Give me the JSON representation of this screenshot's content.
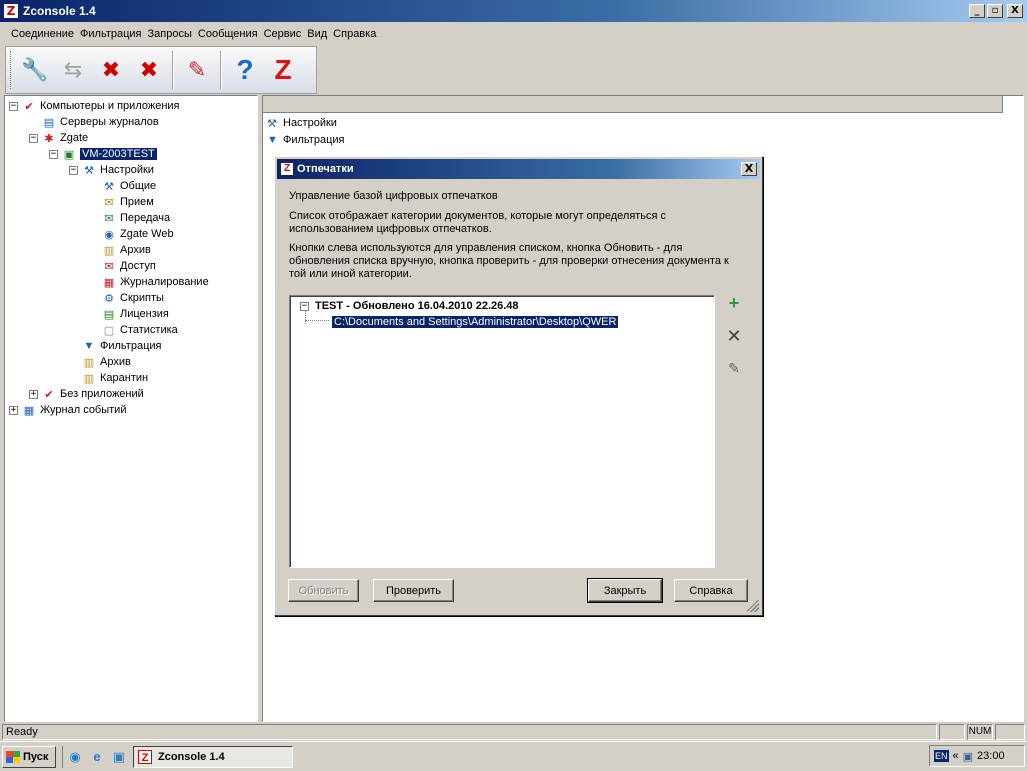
{
  "window": {
    "title": "Zconsole 1.4",
    "app_icon": "Z",
    "controls": {
      "minimize": "_",
      "maximize": "▫",
      "close": "X"
    }
  },
  "menu": [
    "Соединение",
    "Фильтрация",
    "Запросы",
    "Сообщения",
    "Сервис",
    "Вид",
    "Справка"
  ],
  "toolbar": {
    "buttons": [
      {
        "name": "connect-settings-icon",
        "glyph": "🔧"
      },
      {
        "name": "disconnect-icon",
        "glyph": "⇆"
      },
      {
        "name": "delete-server-icon",
        "glyph": "✖"
      },
      {
        "name": "delete-all-icon",
        "glyph": "✖"
      },
      {
        "name": "edit-icon",
        "glyph": "✎"
      },
      {
        "name": "help-icon",
        "glyph": "?"
      },
      {
        "name": "zgate-logo-icon",
        "glyph": "Z"
      }
    ]
  },
  "tree": [
    {
      "label": "Компьютеры и приложения",
      "level": 0,
      "exp": "-",
      "icon": "✔"
    },
    {
      "label": "Серверы журналов",
      "level": 1,
      "exp": "",
      "icon": "▤"
    },
    {
      "label": "Zgate",
      "level": 1,
      "exp": "-",
      "icon": "✱"
    },
    {
      "label": "VM-2003TEST",
      "level": 2,
      "exp": "-",
      "icon": "▣",
      "selected": true
    },
    {
      "label": "Настройки",
      "level": 3,
      "exp": "-",
      "icon": "⚒"
    },
    {
      "label": "Общие",
      "level": 4,
      "exp": "",
      "icon": "⚒"
    },
    {
      "label": "Прием",
      "level": 4,
      "exp": "",
      "icon": "✉"
    },
    {
      "label": "Передача",
      "level": 4,
      "exp": "",
      "icon": "✉"
    },
    {
      "label": "Zgate Web",
      "level": 4,
      "exp": "",
      "icon": "◉"
    },
    {
      "label": "Архив",
      "level": 4,
      "exp": "",
      "icon": "▥"
    },
    {
      "label": "Доступ",
      "level": 4,
      "exp": "",
      "icon": "✉"
    },
    {
      "label": "Журналирование",
      "level": 4,
      "exp": "",
      "icon": "▦"
    },
    {
      "label": "Скрипты",
      "level": 4,
      "exp": "",
      "icon": "⚙"
    },
    {
      "label": "Лицензия",
      "level": 4,
      "exp": "",
      "icon": "▤"
    },
    {
      "label": "Статистика",
      "level": 4,
      "exp": "",
      "icon": "▢"
    },
    {
      "label": "Фильтрация",
      "level": 3,
      "exp": "",
      "icon": "▼"
    },
    {
      "label": "Архив",
      "level": 3,
      "exp": "",
      "icon": "▥"
    },
    {
      "label": "Карантин",
      "level": 3,
      "exp": "",
      "icon": "▥"
    },
    {
      "label": "Без приложений",
      "level": 1,
      "exp": "+",
      "icon": "✔"
    },
    {
      "label": "Журнал событий",
      "level": 0,
      "exp": "+",
      "icon": "▦"
    }
  ],
  "right_items": [
    {
      "label": "Настройки",
      "icon": "⚒"
    },
    {
      "label": "Фильтрация",
      "icon": "▼"
    }
  ],
  "dialog": {
    "title": "Отпечатки",
    "close": "X",
    "heading": "Управление базой цифровых отпечатков",
    "para1_line1": "Список отображает категории документов, которые могут определяться с",
    "para1_line2": "использованием цифровых отпечатков.",
    "para2_line1": "Кнопки слева используются для управления списком, кнопка Обновить - для",
    "para2_line2": "обновления списка вручную, кнопка проверить - для проверки отнесения документа к",
    "para2_line3": "той или иной категории.",
    "list": {
      "category": "TEST - Обновлено 16.04.2010 22.26.48",
      "path": "C:\\Documents and Settings\\Administrator\\Desktop\\QWER"
    },
    "side_buttons": [
      {
        "name": "add-icon",
        "glyph": "+",
        "color": "#2e9a2e"
      },
      {
        "name": "remove-icon",
        "glyph": "✕",
        "color": "#404040"
      },
      {
        "name": "edit-pencil-icon",
        "glyph": "✎",
        "color": "#606060"
      }
    ],
    "buttons": {
      "refresh": "Обновить",
      "check": "Проверить",
      "close": "Закрыть",
      "help": "Справка"
    }
  },
  "status": {
    "text": "Ready",
    "num": "NUM"
  },
  "taskbar": {
    "start": "Пуск",
    "task": "Zconsole 1.4",
    "lang": "EN",
    "clock": "23:00"
  }
}
